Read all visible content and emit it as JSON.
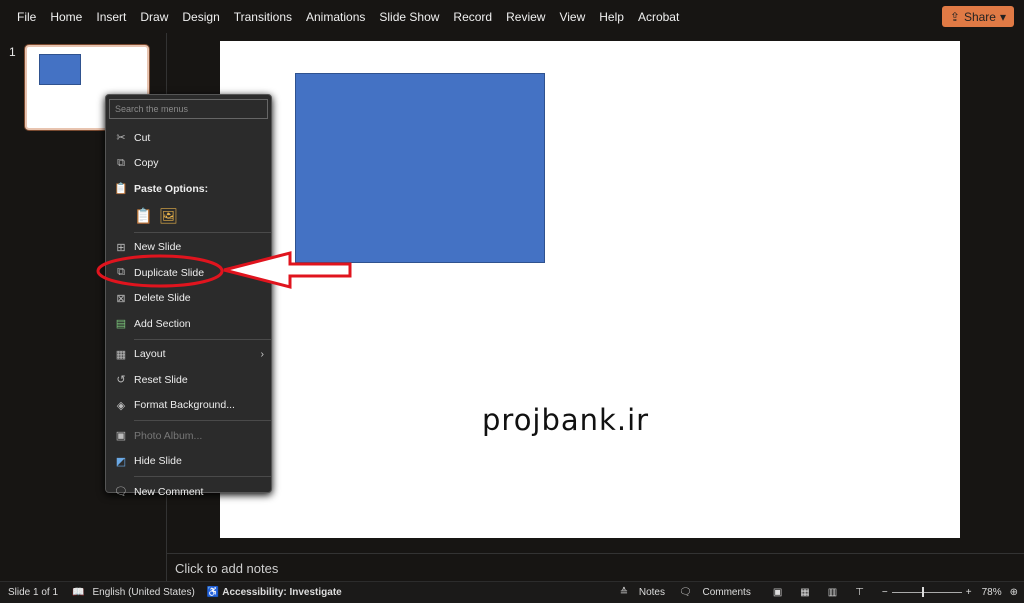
{
  "menubar": {
    "items": [
      "File",
      "Home",
      "Insert",
      "Draw",
      "Design",
      "Transitions",
      "Animations",
      "Slide Show",
      "Record",
      "Review",
      "View",
      "Help",
      "Acrobat"
    ],
    "share": "Share"
  },
  "thumbnail": {
    "number": "1"
  },
  "slide": {
    "watermark": "projbank.ir",
    "shape_color": "#4472c4"
  },
  "notes": {
    "placeholder": "Click to add notes"
  },
  "context_menu": {
    "search_placeholder": "Search the menus",
    "items": [
      {
        "label": "Cut",
        "icon": "scissors-icon"
      },
      {
        "label": "Copy",
        "icon": "copy-icon"
      },
      {
        "label": "Paste Options:",
        "icon": "clipboard-icon"
      },
      {
        "label": "New Slide",
        "icon": "new-slide-icon"
      },
      {
        "label": "Duplicate Slide",
        "icon": "duplicate-icon"
      },
      {
        "label": "Delete Slide",
        "icon": "delete-slide-icon"
      },
      {
        "label": "Add Section",
        "icon": "section-icon"
      },
      {
        "label": "Layout",
        "icon": "layout-icon"
      },
      {
        "label": "Reset Slide",
        "icon": "reset-icon"
      },
      {
        "label": "Format Background...",
        "icon": "paint-icon"
      },
      {
        "label": "Photo Album...",
        "icon": "photo-album-icon",
        "disabled": true
      },
      {
        "label": "Hide Slide",
        "icon": "hide-slide-icon"
      },
      {
        "label": "New Comment",
        "icon": "comment-icon"
      }
    ]
  },
  "annotation": {
    "color": "#e0141e"
  },
  "status": {
    "slide": "Slide 1 of 1",
    "language": "English (United States)",
    "accessibility": "Accessibility: Investigate",
    "notes": "Notes",
    "comments": "Comments",
    "zoom": "78%"
  }
}
